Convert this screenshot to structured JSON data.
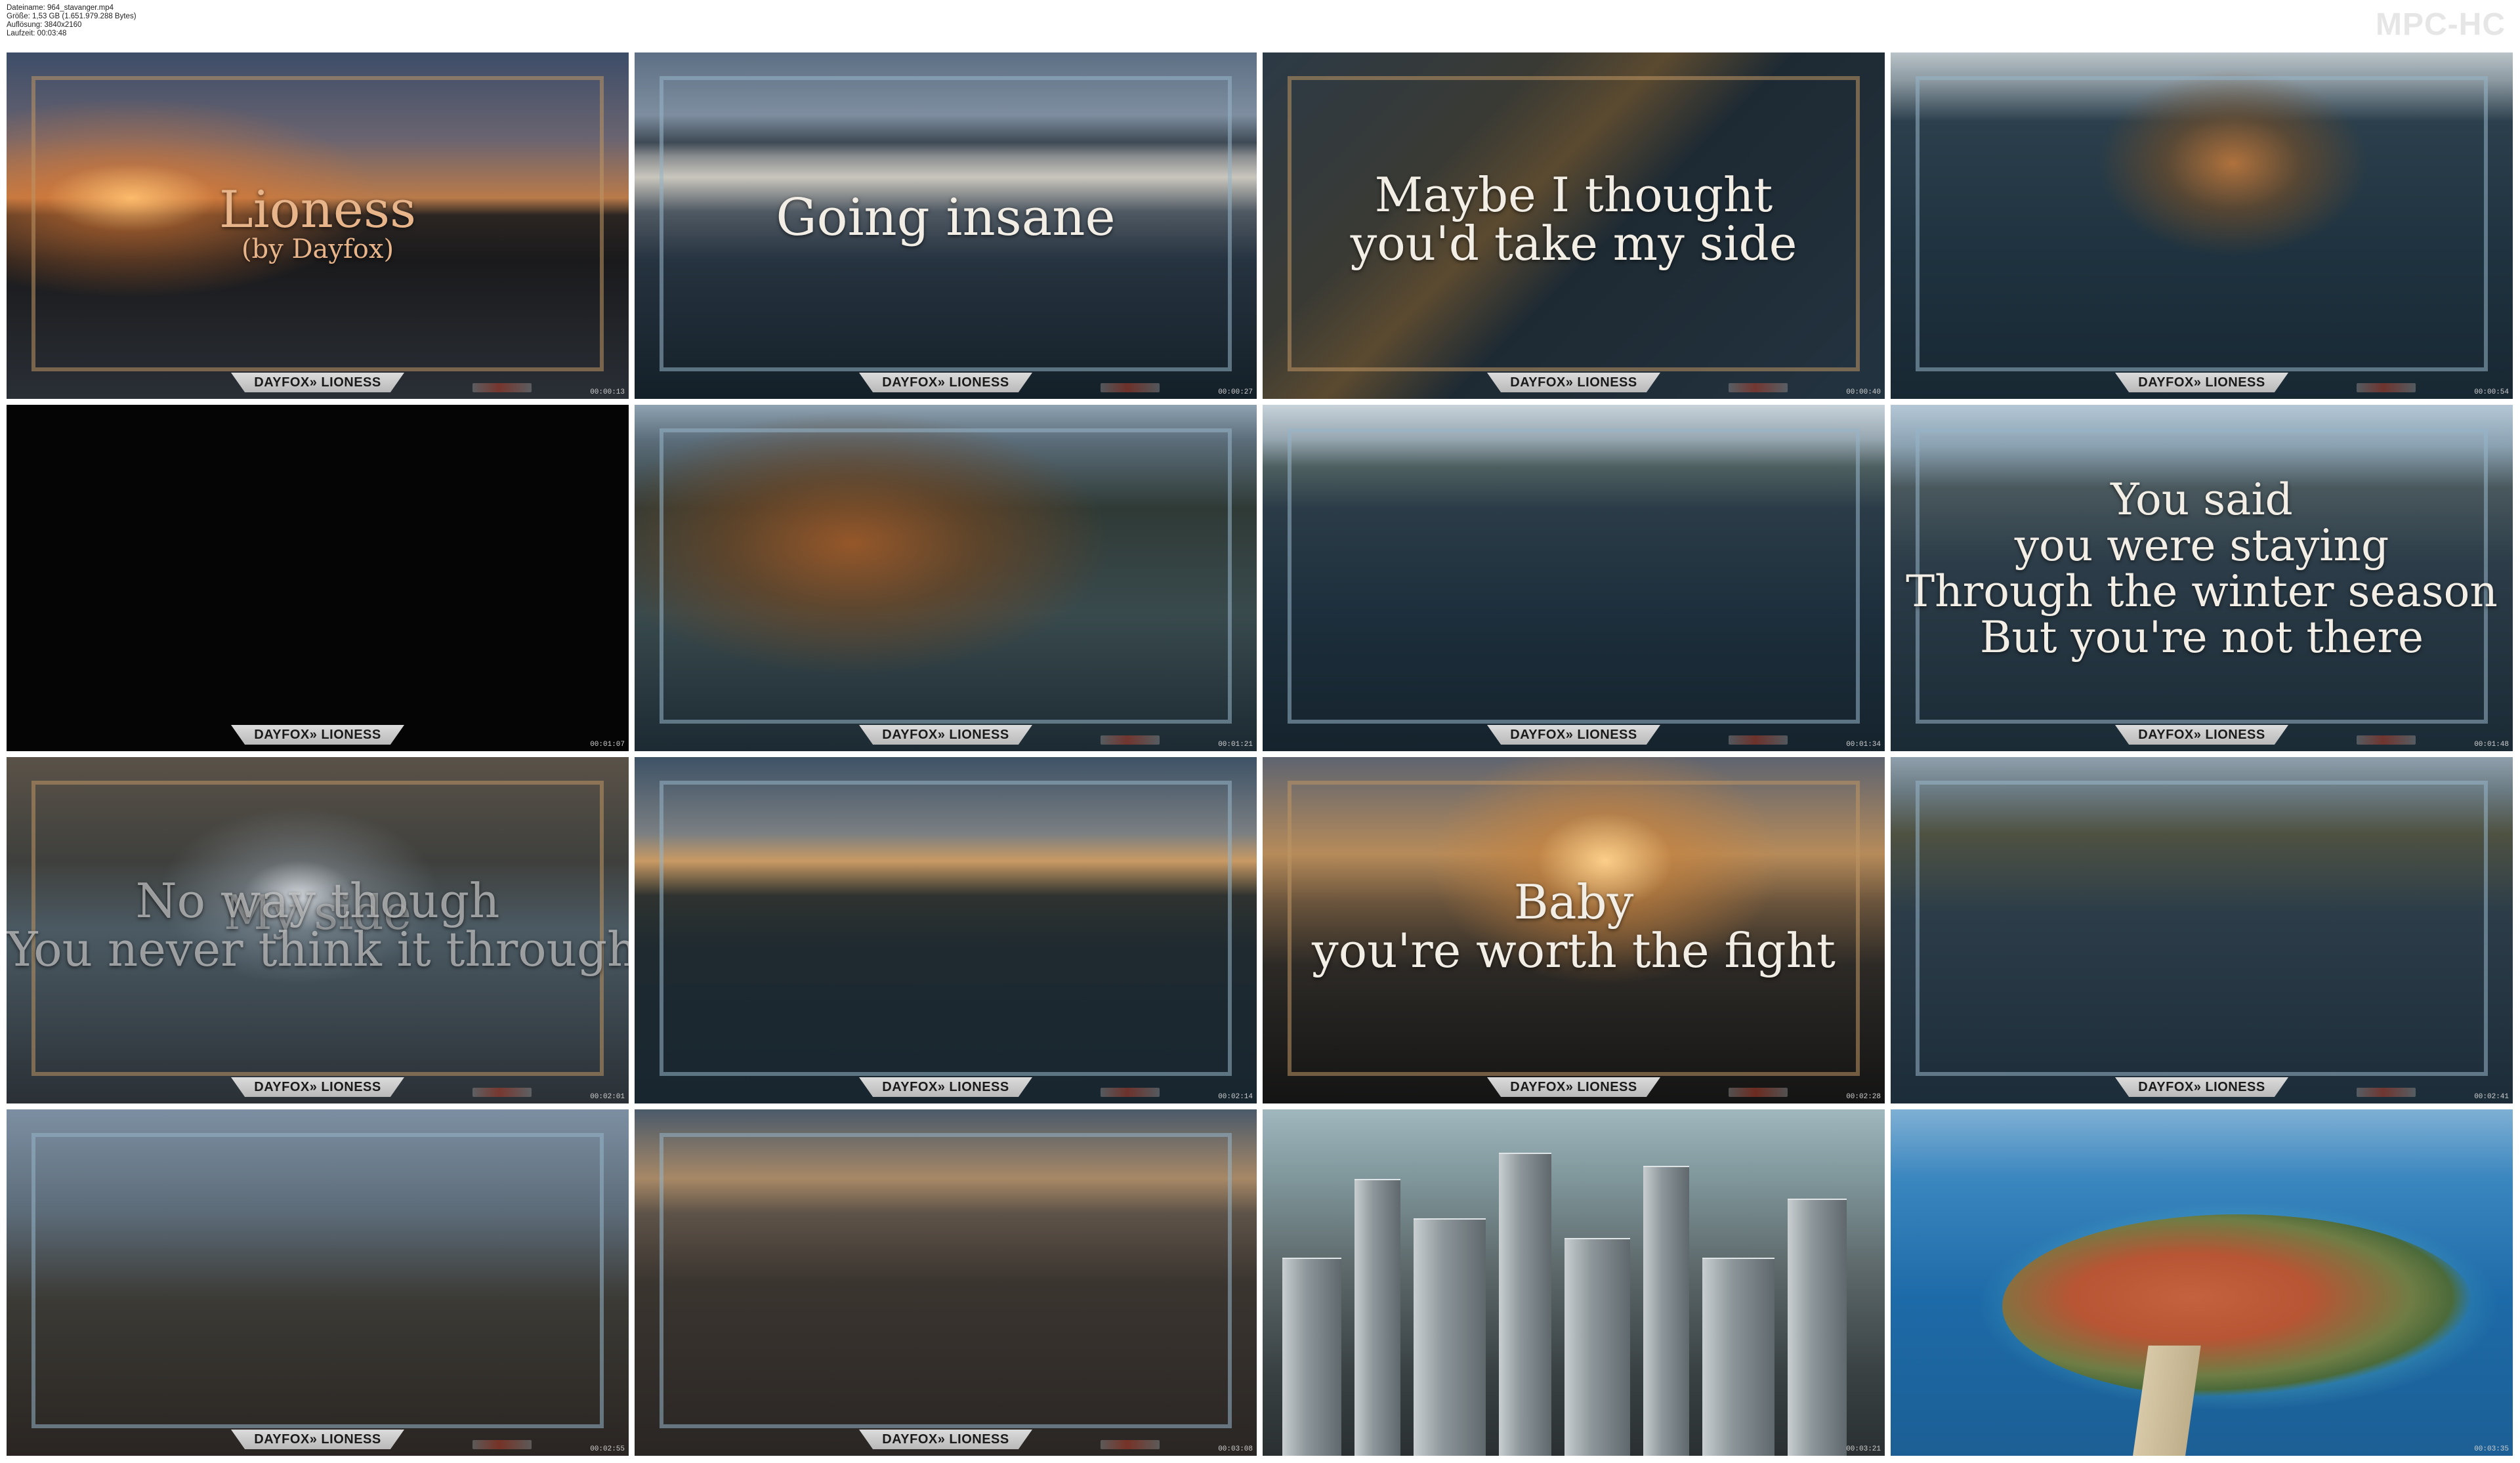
{
  "header": {
    "info_lines": [
      "Dateiname: 964_stavanger.mp4",
      "Größe: 1,53 GB (1.651.979.288 Bytes)",
      "Auflösung: 3840x2160",
      "Laufzeit: 00:03:48"
    ],
    "brand": "MPC-HC"
  },
  "tiles": [
    {
      "timestamp": "00:00:13",
      "banner": "DAYFOX» LIONESS",
      "title": "Lioness",
      "subtitle": "(by Dayfox)"
    },
    {
      "timestamp": "00:00:27",
      "banner": "DAYFOX» LIONESS",
      "lyrics": [
        "Going insane"
      ]
    },
    {
      "timestamp": "00:00:40",
      "banner": "DAYFOX» LIONESS",
      "lyrics": [
        "Maybe I thought",
        "you'd take my side"
      ]
    },
    {
      "timestamp": "00:00:54",
      "banner": "DAYFOX» LIONESS"
    },
    {
      "timestamp": ""
    },
    {
      "timestamp": "00:01:07",
      "banner": "DAYFOX» LIONESS"
    },
    {
      "timestamp": "00:01:21",
      "banner": "DAYFOX» LIONESS"
    },
    {
      "timestamp": "00:01:34",
      "banner": "DAYFOX» LIONESS"
    },
    {
      "timestamp": "00:01:48",
      "banner": "DAYFOX» LIONESS",
      "lyrics": [
        "You said",
        "you were staying",
        "Through the winter season",
        "But you're not there"
      ]
    },
    {
      "timestamp": "00:02:01",
      "banner": "DAYFOX» LIONESS",
      "lyrics": [
        "No way though",
        "You never think it through"
      ],
      "ghost": "My side"
    },
    {
      "timestamp": "00:02:14",
      "banner": "DAYFOX» LIONESS"
    },
    {
      "timestamp": "00:02:28",
      "banner": "DAYFOX» LIONESS",
      "lyrics": [
        "Baby",
        "you're worth the fight"
      ]
    },
    {
      "timestamp": "00:02:41",
      "banner": "DAYFOX» LIONESS"
    },
    {
      "timestamp": "00:02:55",
      "banner": "DAYFOX» LIONESS"
    },
    {
      "timestamp": "00:03:08",
      "banner": "DAYFOX» LIONESS"
    },
    {
      "timestamp": "00:03:21"
    },
    {
      "timestamp": "00:03:35"
    }
  ]
}
